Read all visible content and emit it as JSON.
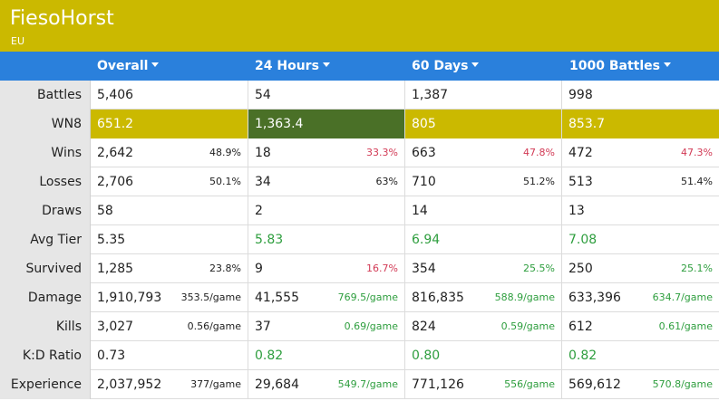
{
  "player": {
    "name": "FiesoHorst",
    "region": "EU"
  },
  "columns": [
    {
      "label": "Overall"
    },
    {
      "label": "24 Hours"
    },
    {
      "label": "60 Days"
    },
    {
      "label": "1000 Battles"
    }
  ],
  "rows": [
    {
      "label": "Battles",
      "cells": [
        {
          "value": "5,406"
        },
        {
          "value": "54"
        },
        {
          "value": "1,387"
        },
        {
          "value": "998"
        }
      ]
    },
    {
      "label": "WN8",
      "cells": [
        {
          "value": "651.2"
        },
        {
          "value": "1,363.4"
        },
        {
          "value": "805"
        },
        {
          "value": "853.7"
        }
      ]
    },
    {
      "label": "Wins",
      "cells": [
        {
          "value": "2,642",
          "sub": "48.9%"
        },
        {
          "value": "18",
          "sub": "33.3%"
        },
        {
          "value": "663",
          "sub": "47.8%"
        },
        {
          "value": "472",
          "sub": "47.3%"
        }
      ]
    },
    {
      "label": "Losses",
      "cells": [
        {
          "value": "2,706",
          "sub": "50.1%"
        },
        {
          "value": "34",
          "sub": "63%"
        },
        {
          "value": "710",
          "sub": "51.2%"
        },
        {
          "value": "513",
          "sub": "51.4%"
        }
      ]
    },
    {
      "label": "Draws",
      "cells": [
        {
          "value": "58"
        },
        {
          "value": "2"
        },
        {
          "value": "14"
        },
        {
          "value": "13"
        }
      ]
    },
    {
      "label": "Avg Tier",
      "cells": [
        {
          "value": "5.35"
        },
        {
          "value": "5.83"
        },
        {
          "value": "6.94"
        },
        {
          "value": "7.08"
        }
      ]
    },
    {
      "label": "Survived",
      "cells": [
        {
          "value": "1,285",
          "sub": "23.8%"
        },
        {
          "value": "9",
          "sub": "16.7%"
        },
        {
          "value": "354",
          "sub": "25.5%"
        },
        {
          "value": "250",
          "sub": "25.1%"
        }
      ]
    },
    {
      "label": "Damage",
      "cells": [
        {
          "value": "1,910,793",
          "sub": "353.5/game"
        },
        {
          "value": "41,555",
          "sub": "769.5/game"
        },
        {
          "value": "816,835",
          "sub": "588.9/game"
        },
        {
          "value": "633,396",
          "sub": "634.7/game"
        }
      ]
    },
    {
      "label": "Kills",
      "cells": [
        {
          "value": "3,027",
          "sub": "0.56/game"
        },
        {
          "value": "37",
          "sub": "0.69/game"
        },
        {
          "value": "824",
          "sub": "0.59/game"
        },
        {
          "value": "612",
          "sub": "0.61/game"
        }
      ]
    },
    {
      "label": "K:D Ratio",
      "cells": [
        {
          "value": "0.73"
        },
        {
          "value": "0.82"
        },
        {
          "value": "0.80"
        },
        {
          "value": "0.82"
        }
      ]
    },
    {
      "label": "Experience",
      "cells": [
        {
          "value": "2,037,952",
          "sub": "377/game"
        },
        {
          "value": "29,684",
          "sub": "549.7/game"
        },
        {
          "value": "771,126",
          "sub": "556/game"
        },
        {
          "value": "569,612",
          "sub": "570.8/game"
        }
      ]
    }
  ],
  "colors": {
    "banner": "#cbb900",
    "header": "#2a80dc",
    "wn8_average": "#cbb900",
    "wn8_good": "#4a7027",
    "better": "#2e9e3e",
    "worse": "#d23a55"
  }
}
